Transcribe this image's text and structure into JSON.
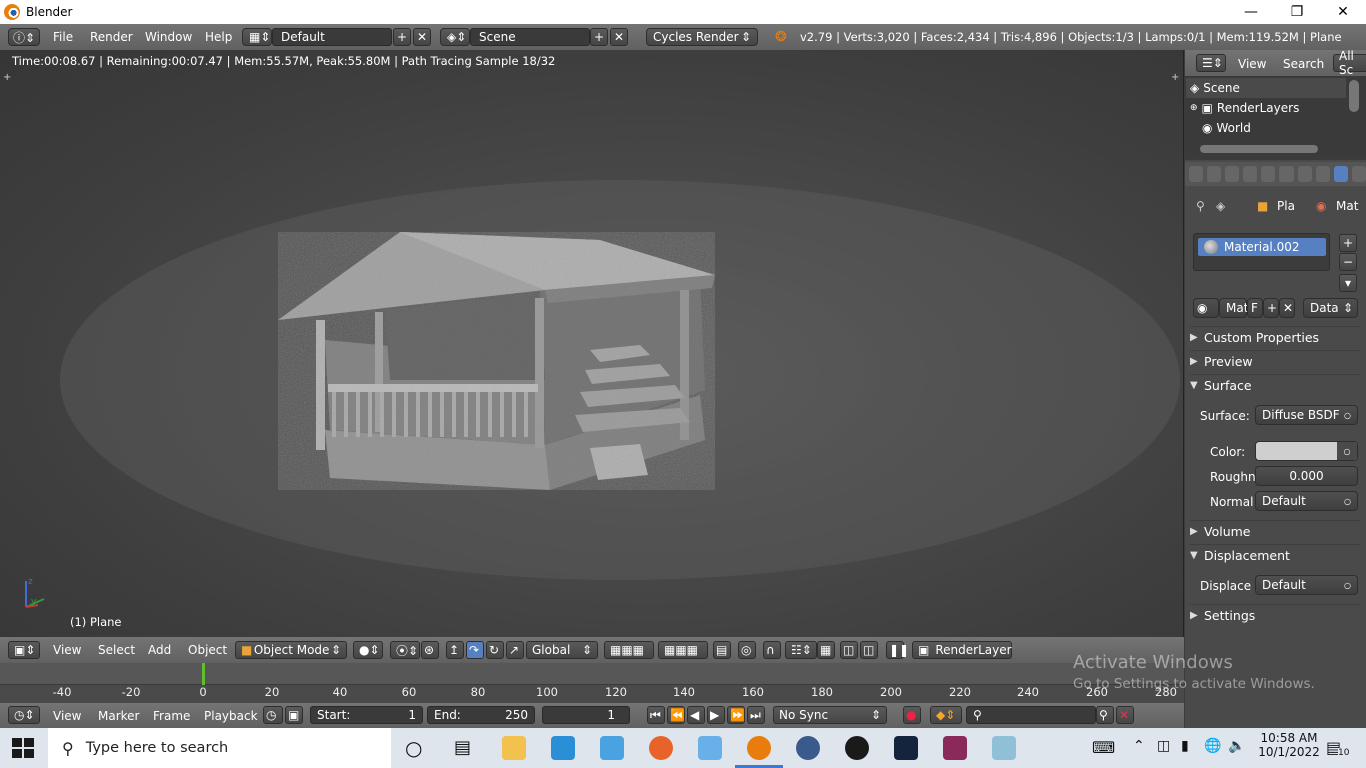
{
  "window": {
    "title": "Blender"
  },
  "infobar": {
    "menus": [
      "File",
      "Render",
      "Window",
      "Help"
    ],
    "screen_layout": "Default",
    "scene": "Scene",
    "render_engine": "Cycles Render",
    "stats": "v2.79 | Verts:3,020 | Faces:2,434 | Tris:4,896 | Objects:1/3 | Lamps:0/1 | Mem:119.52M | Plane"
  },
  "viewport": {
    "render_status": "Time:00:08.67 | Remaining:00:07.47 | Mem:55.57M, Peak:55.80M | Path Tracing Sample 18/32",
    "object_label": "(1) Plane"
  },
  "view3d_header": {
    "menus": [
      "View",
      "Select",
      "Add",
      "Object"
    ],
    "mode": "Object Mode",
    "orientation": "Global",
    "render_layer": "RenderLayer"
  },
  "timeline": {
    "ticks": [
      "-40",
      "-20",
      "0",
      "20",
      "40",
      "60",
      "80",
      "100",
      "120",
      "140",
      "160",
      "180",
      "200",
      "220",
      "240",
      "260",
      "280"
    ],
    "menus": [
      "View",
      "Marker",
      "Frame",
      "Playback"
    ],
    "start_label": "Start:",
    "start_value": "1",
    "end_label": "End:",
    "end_value": "250",
    "current_frame": "1",
    "sync": "No Sync"
  },
  "outliner": {
    "menus": [
      "View",
      "Search"
    ],
    "filter": "All Sc",
    "items": [
      "Scene",
      "RenderLayers",
      "World"
    ]
  },
  "properties": {
    "breadcrumb_object": "Pla",
    "breadcrumb_material": "Mat",
    "material_slot": "Material.002",
    "material_short": "Mat",
    "fake_user": "F",
    "link": "Data",
    "panels": {
      "custom_properties": "Custom Properties",
      "preview": "Preview",
      "surface": "Surface",
      "volume": "Volume",
      "displacement": "Displacement",
      "settings": "Settings"
    },
    "surface_label": "Surface:",
    "surface_value": "Diffuse BSDF",
    "color_label": "Color:",
    "roughness_label": "Roughn",
    "roughness_value": "0.000",
    "normal_label": "Normal",
    "normal_value": "Default",
    "displace_label": "Displace",
    "displace_value": "Default"
  },
  "watermark": {
    "line1": "Activate Windows",
    "line2": "Go to Settings to activate Windows."
  },
  "taskbar": {
    "search_placeholder": "Type here to search",
    "time": "10:58 AM",
    "date": "10/1/2022",
    "notification_count": "10"
  },
  "colors": {
    "accent": "#5680c2",
    "header": "#6c6c6c",
    "playhead": "#5fbf2a"
  }
}
